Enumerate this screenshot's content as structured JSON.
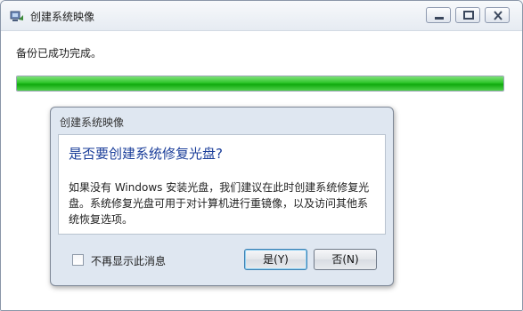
{
  "window": {
    "title": "创建系统映像",
    "status_text": "备份已成功完成。",
    "progress": 100
  },
  "dialog": {
    "title": "创建系统映像",
    "heading": "是否要创建系统修复光盘?",
    "message": "如果没有 Windows 安装光盘，我们建议在此时创建系统修复光盘。系统修复光盘可用于对计算机进行重镜像，以及访问其他系统恢复选项。",
    "checkbox_label": "不再显示此消息",
    "yes_label": "是(Y)",
    "no_label": "否(N)"
  },
  "colors": {
    "progress_fill": "#1fbf1b",
    "heading": "#1b3e9a"
  },
  "icons": {
    "app": "backup-app-icon",
    "minimize": "minimize-icon",
    "maximize": "maximize-icon",
    "close": "close-icon"
  }
}
